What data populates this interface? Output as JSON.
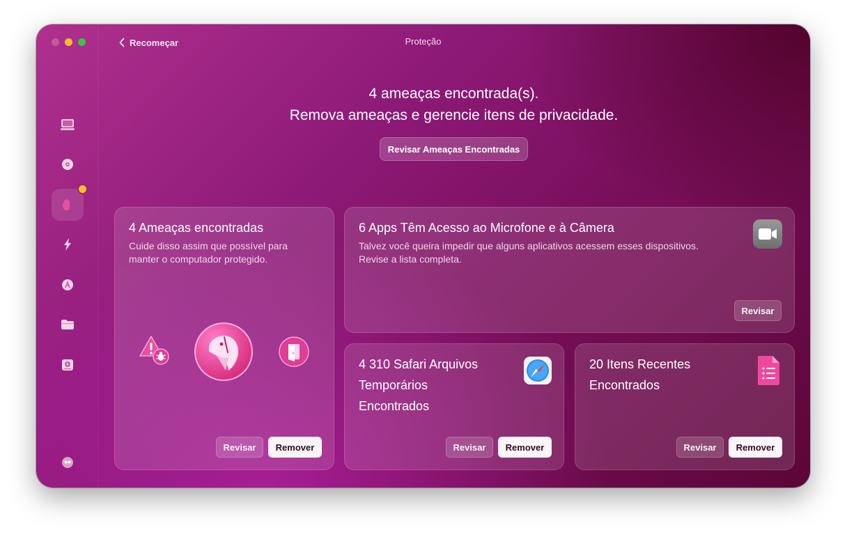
{
  "window": {
    "title": "Proteção",
    "back_label": "Recomeçar"
  },
  "sidebar": {
    "items": [
      {
        "icon": "monitor-icon"
      },
      {
        "icon": "disc-icon"
      },
      {
        "icon": "hand-icon",
        "active": true,
        "badge_color": "#f5c22c"
      },
      {
        "icon": "lightning-icon"
      },
      {
        "icon": "apps-icon"
      },
      {
        "icon": "folder-icon"
      },
      {
        "icon": "disk-icon"
      }
    ],
    "footer_icon": "assistant-icon"
  },
  "header": {
    "line1": "4 ameaças encontrada(s).",
    "line2": "Remova ameaças e gerencie itens de privacidade.",
    "review_button": "Revisar Ameaças Encontradas"
  },
  "cards": {
    "threats": {
      "title": "4 Ameaças encontradas",
      "description": "Cuide disso assim que possível para manter o computador protegido.",
      "review": "Revisar",
      "remove": "Remover"
    },
    "mic_camera": {
      "title": "6 Apps Têm Acesso ao Microfone e à Câmera",
      "description_line1": "Talvez você queira impedir que alguns aplicativos acessem esses dispositivos.",
      "description_line2": "Revise a lista completa.",
      "review": "Revisar"
    },
    "safari": {
      "title_line1": "4 310 Safari Arquivos",
      "title_line2": "Temporários",
      "title_line3": "Encontrados",
      "review": "Revisar",
      "remove": "Remover"
    },
    "recent": {
      "title_line1": "20 Itens Recentes",
      "title_line2": "Encontrados",
      "review": "Revisar",
      "remove": "Remover"
    }
  },
  "colors": {
    "accent_pink": "#e8509f",
    "warning_yellow": "#f5c22c"
  }
}
